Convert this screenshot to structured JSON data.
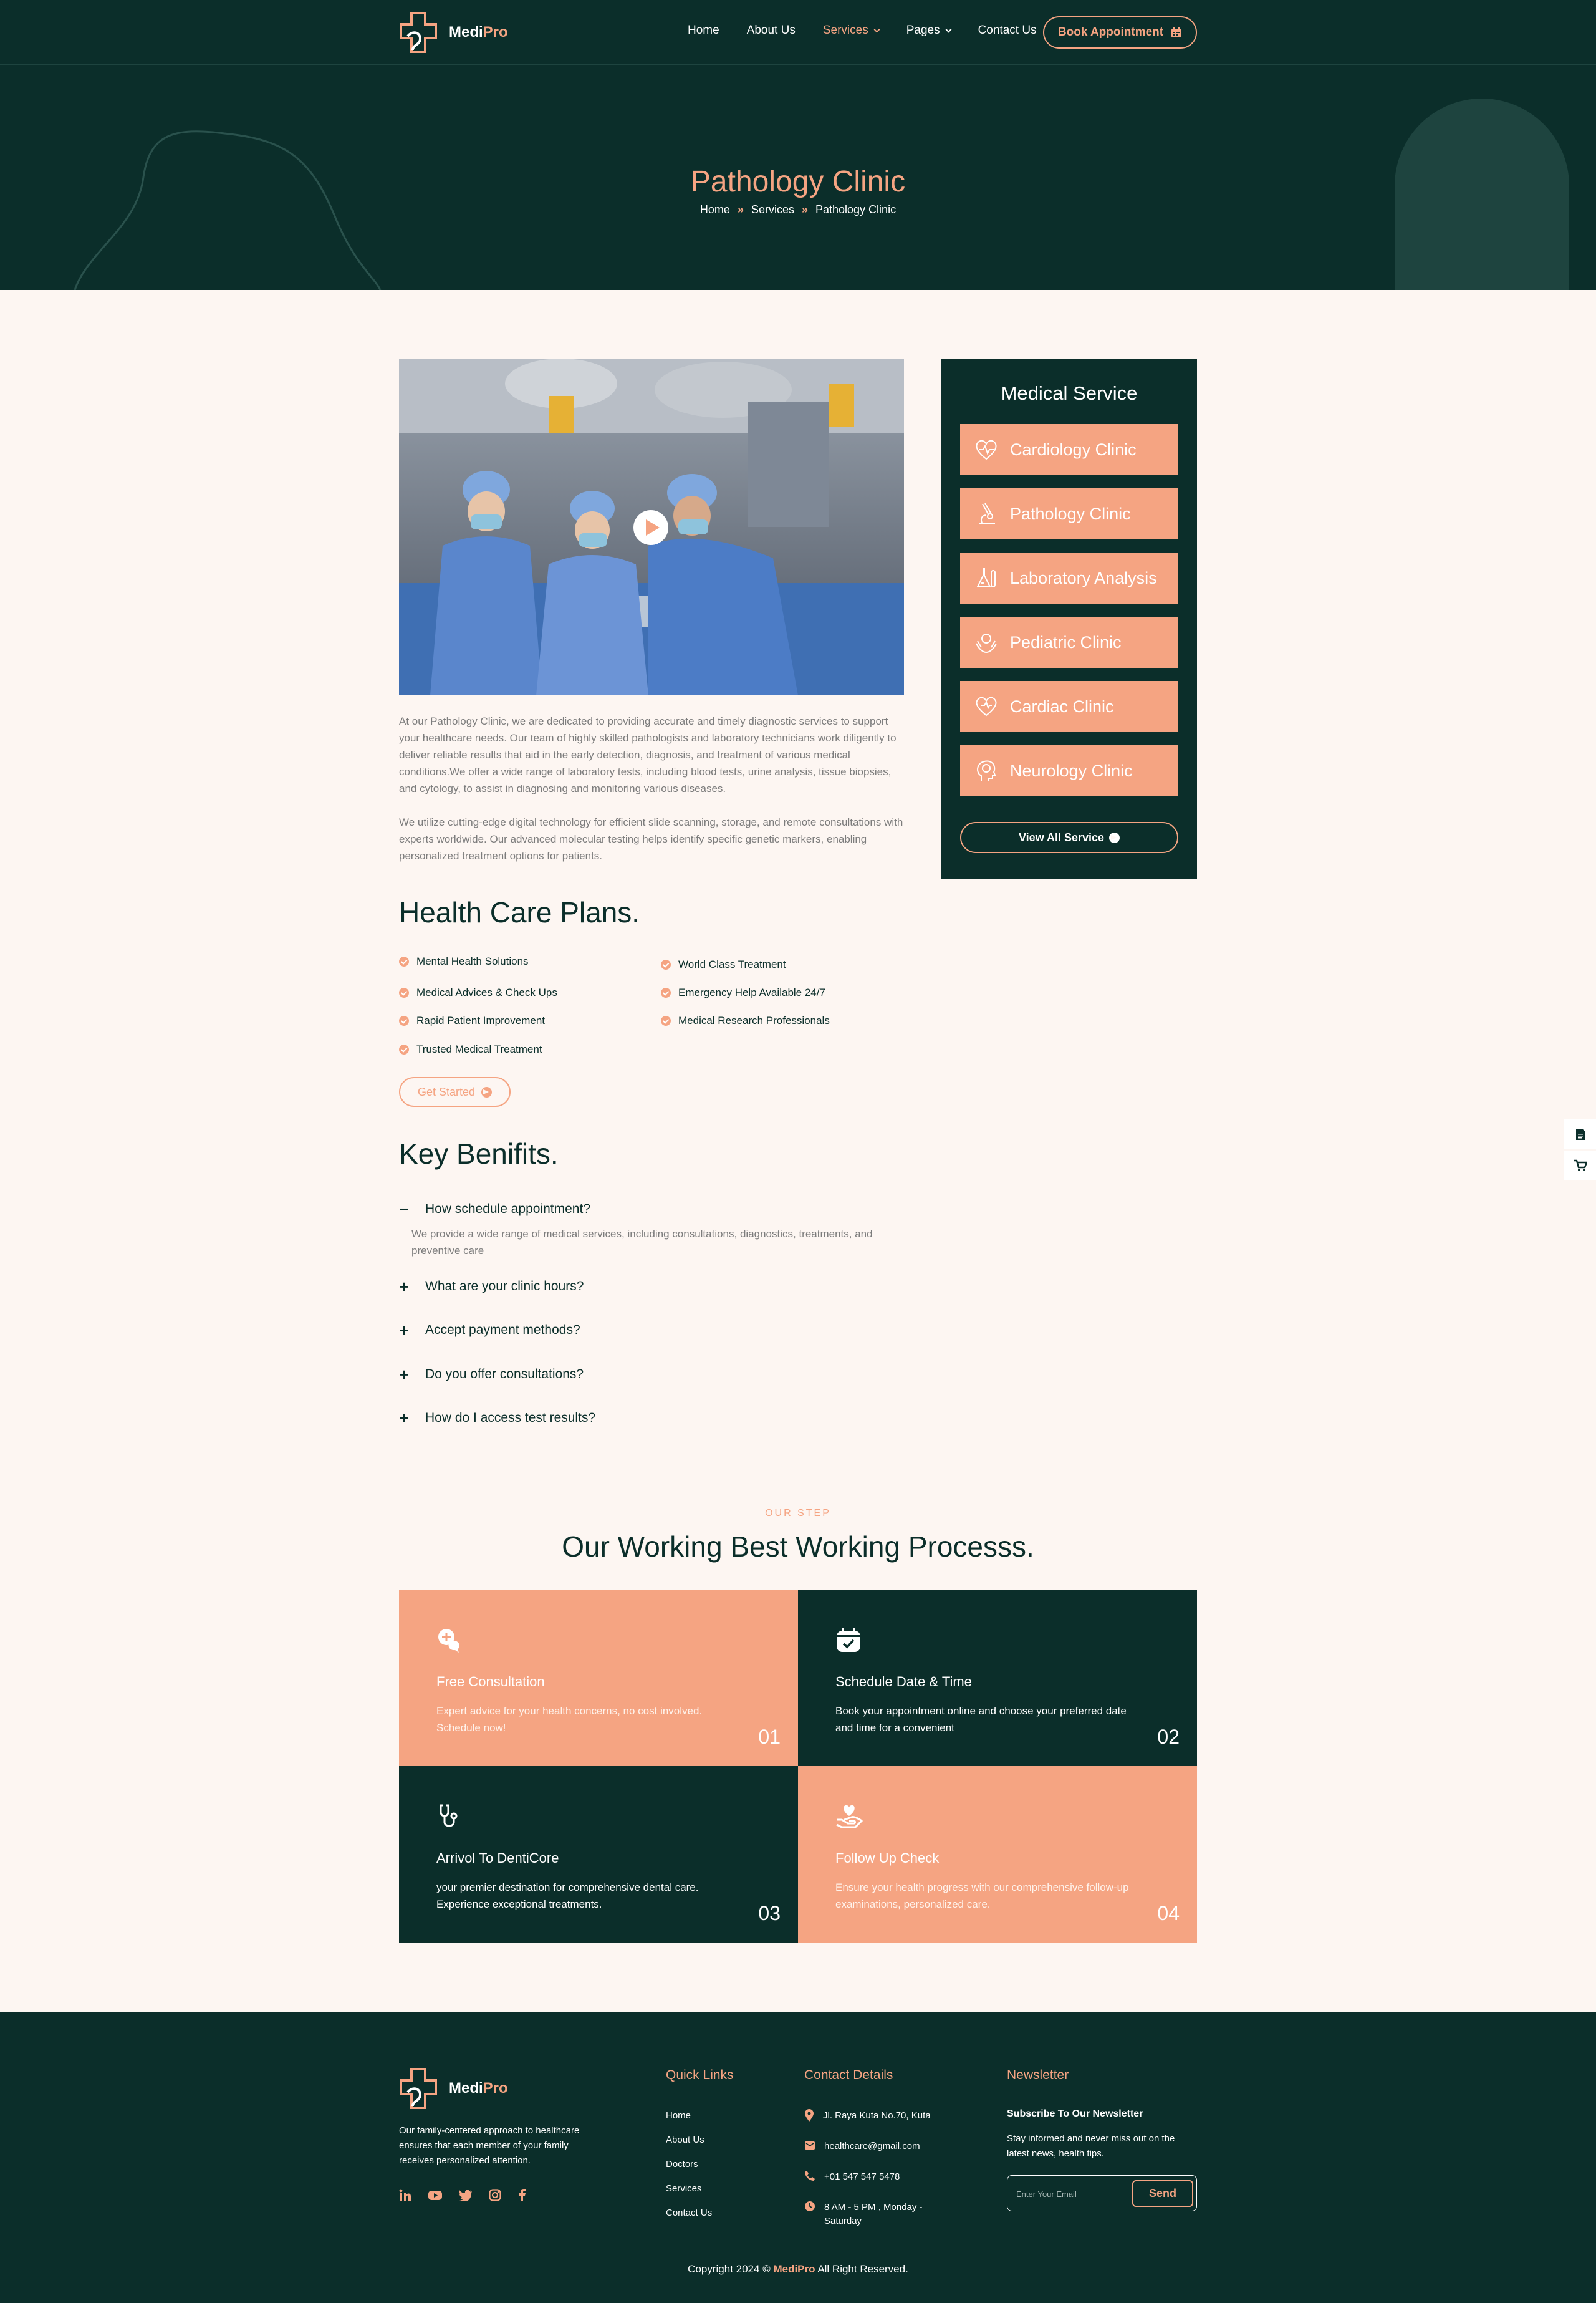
{
  "brand": {
    "name_a": "Medi",
    "name_b": "Pro"
  },
  "nav": {
    "links": [
      {
        "label": "Home"
      },
      {
        "label": "About Us"
      },
      {
        "label": "Services"
      },
      {
        "label": "Pages"
      },
      {
        "label": "Contact Us"
      }
    ],
    "active": "Services",
    "book_label": "Book Appointment"
  },
  "hero": {
    "title": "Pathology Clinic",
    "breadcrumb": [
      "Home",
      "Services",
      "Pathology Clinic"
    ]
  },
  "main": {
    "para1": "At our Pathology Clinic, we are dedicated to providing accurate and timely diagnostic services to support your healthcare needs. Our team of highly skilled pathologists and laboratory technicians work diligently to deliver reliable results that aid in the early detection, diagnosis, and treatment of various medical conditions.We offer a wide range of laboratory tests, including blood tests, urine analysis, tissue biopsies, and cytology, to assist in diagnosing and monitoring various diseases.",
    "para2": "We utilize cutting-edge digital technology for efficient slide scanning, storage, and remote consultations with experts worldwide. Our advanced molecular testing helps identify specific genetic markers, enabling personalized treatment options for patients.",
    "plans_title": "Health Care Plans.",
    "plans_left": [
      "Mental Health Solutions",
      "Medical Advices & Check Ups",
      "Rapid Patient Improvement",
      "Trusted Medical Treatment"
    ],
    "plans_right": [
      "World Class Treatment",
      "Emergency Help Available 24/7",
      "Medical Research Professionals"
    ],
    "get_started": "Get Started",
    "benefits_title": "Key Benifits.",
    "faq": [
      {
        "q": "How schedule appointment?",
        "a": "We provide a wide range of medical services, including consultations, diagnostics, treatments, and preventive care",
        "open": true
      },
      {
        "q": "What are your clinic hours?"
      },
      {
        "q": "Accept payment methods?"
      },
      {
        "q": "Do you offer consultations?"
      },
      {
        "q": "How do I access test results?"
      }
    ]
  },
  "sidebar": {
    "title": "Medical Service",
    "items": [
      {
        "label": "Cardiology Clinic",
        "icon": "heart-pulse-icon"
      },
      {
        "label": "Pathology Clinic",
        "icon": "microscope-icon"
      },
      {
        "label": "Laboratory Analysis",
        "icon": "lab-flask-icon"
      },
      {
        "label": "Pediatric Clinic",
        "icon": "baby-hands-icon"
      },
      {
        "label": "Cardiac Clinic",
        "icon": "heart-icon"
      },
      {
        "label": "Neurology Clinic",
        "icon": "brain-head-icon"
      }
    ],
    "view_all": "View All Service"
  },
  "steps": {
    "tag": "OUR STEP",
    "title": "Our Working Best Working Processs.",
    "cards": [
      {
        "title": "Free Consultation",
        "desc": "Expert advice for your health concerns, no cost involved. Schedule now!",
        "num": "01",
        "icon": "consultation-chat-icon"
      },
      {
        "title": "Schedule Date & Time",
        "desc": "Book your appointment online and choose your preferred date and time for a convenient",
        "num": "02",
        "icon": "calendar-check-icon"
      },
      {
        "title": "Arrivol To DentiCore",
        "desc": "your premier destination for comprehensive dental care. Experience exceptional treatments.",
        "num": "03",
        "icon": "stethoscope-icon"
      },
      {
        "title": "Follow Up Check",
        "desc": "Ensure your health progress with our comprehensive follow-up examinations, personalized care.",
        "num": "04",
        "icon": "hand-heart-icon"
      }
    ]
  },
  "footer": {
    "about": "Our family-centered approach to healthcare ensures that each member of your family receives personalized attention.",
    "quick_title": "Quick Links",
    "quick_links": [
      "Home",
      "About Us",
      "Doctors",
      "Services",
      "Contact Us"
    ],
    "contact_title": "Contact Details",
    "contacts": [
      {
        "text": "Jl. Raya Kuta No.70, Kuta",
        "icon": "location-pin-icon"
      },
      {
        "text": "healthcare@gmail.com",
        "icon": "mail-icon"
      },
      {
        "text": "+01 547 547 5478",
        "icon": "phone-icon"
      },
      {
        "text": "8 AM - 5 PM , Monday - Saturday",
        "icon": "clock-icon"
      }
    ],
    "newsletter_title": "Newsletter",
    "newsletter_sub": "Subscribe To Our Newsletter",
    "newsletter_desc": "Stay informed and never miss out on the latest news, health tips.",
    "email_placeholder": "Enter Your Email",
    "send_label": "Send",
    "copyright_a": "Copyright 2024 ©",
    "copyright_brand": "MediPro",
    "copyright_b": "All Right Reserved.",
    "socials": [
      "linkedin-icon",
      "youtube-icon",
      "twitter-icon",
      "instagram-icon",
      "facebook-icon"
    ]
  },
  "colors": {
    "primary": "#0b2e2a",
    "accent": "#f5a482",
    "background": "#fdf6f2"
  }
}
